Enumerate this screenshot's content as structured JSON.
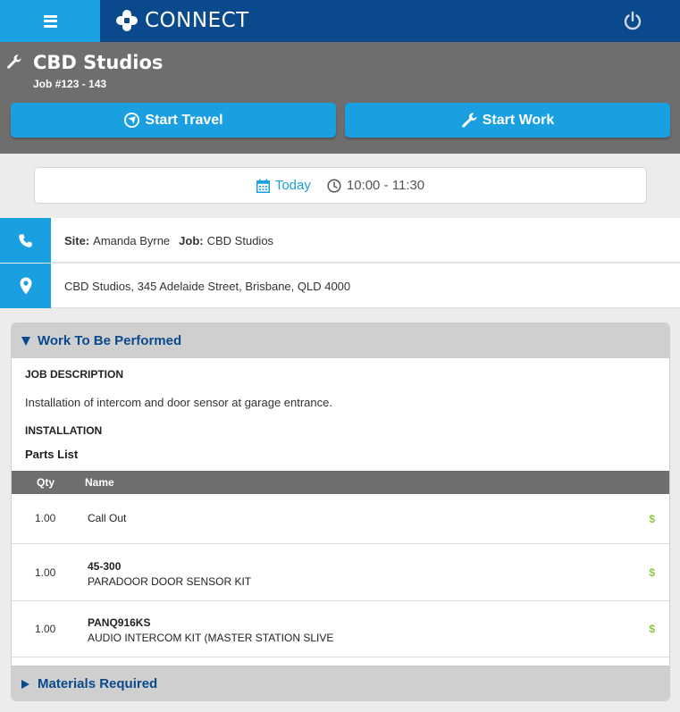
{
  "app": {
    "brand": "CONNECT"
  },
  "job": {
    "title": "CBD Studios",
    "number": "Job #123 - 143",
    "start_travel_label": "Start Travel",
    "start_work_label": "Start Work"
  },
  "schedule": {
    "day": "Today",
    "time": "10:00 - 11:30"
  },
  "contact": {
    "site_label": "Site:",
    "site_value": "Amanda Byrne",
    "job_label": "Job:",
    "job_value": "CBD Studios"
  },
  "address": "CBD Studios, 345 Adelaide Street, Brisbane, QLD 4000",
  "work": {
    "heading": "Work To Be Performed",
    "job_description_label": "JOB DESCRIPTION",
    "job_description": "Installation of intercom and door sensor at garage entrance.",
    "installation_label": "INSTALLATION",
    "parts_list_label": "Parts List",
    "columns": {
      "qty": "Qty",
      "name": "Name"
    },
    "parts": [
      {
        "qty": "1.00",
        "code": "",
        "name": "Call Out",
        "price": "$"
      },
      {
        "qty": "1.00",
        "code": "45-300",
        "name": "PARADOOR DOOR SENSOR KIT",
        "price": "$"
      },
      {
        "qty": "1.00",
        "code": "PANQ916KS",
        "name": "AUDIO INTERCOM KIT (MASTER STATION SLIVE",
        "price": "$"
      }
    ]
  },
  "materials": {
    "heading": "Materials Required"
  },
  "colors": {
    "primary": "#0a4a8c",
    "accent": "#1a9fe0",
    "price": "#8cc63f",
    "header_gray": "#6e6e6e"
  },
  "icons": [
    "menu-icon",
    "connect-logo-icon",
    "power-icon",
    "wrench-icon",
    "compass-icon",
    "calendar-icon",
    "clock-icon",
    "phone-icon",
    "map-pin-icon"
  ]
}
